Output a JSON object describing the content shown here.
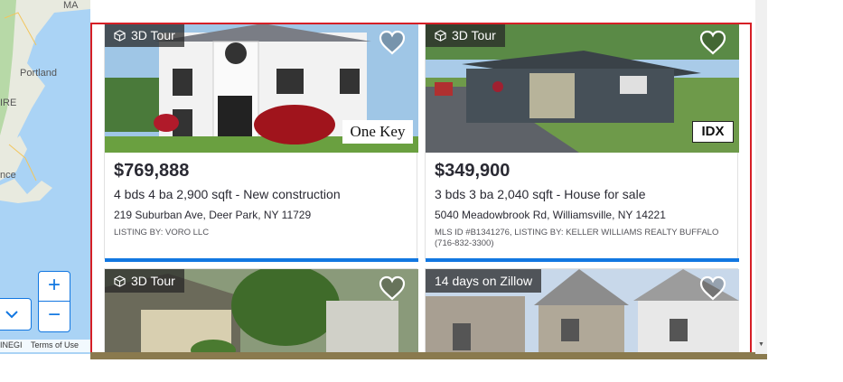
{
  "map": {
    "labels": [
      "MA",
      "Portland",
      "IRE",
      "nce"
    ],
    "zoom_in": "+",
    "zoom_out": "−",
    "attribution_left": "INEGI",
    "attribution_terms": "Terms of Use"
  },
  "listings": [
    {
      "badge": "3D Tour",
      "price": "$769,888",
      "beds": "4 bds",
      "baths": "4 ba",
      "sqft": "2,900 sqft",
      "status": "- New construction",
      "address": "219 Suburban Ave, Deer Park, NY 11729",
      "listing_by": "LISTING BY: VORO LLC",
      "logo": "One Key"
    },
    {
      "badge": "3D Tour",
      "price": "$349,900",
      "beds": "3 bds",
      "baths": "3 ba",
      "sqft": "2,040 sqft",
      "status": "- House for sale",
      "address": "5040 Meadowbrook Rd, Williamsville, NY 14221",
      "listing_by": "MLS ID #B1341276, LISTING BY: KELLER WILLIAMS REALTY BUFFALO (716-832-3300)",
      "logo": "IDX"
    },
    {
      "badge": "3D Tour"
    },
    {
      "badge": "14 days on Zillow"
    }
  ],
  "colors": {
    "accent": "#1277e1",
    "highlight_border": "#d61f26",
    "text": "#2a2a33"
  }
}
